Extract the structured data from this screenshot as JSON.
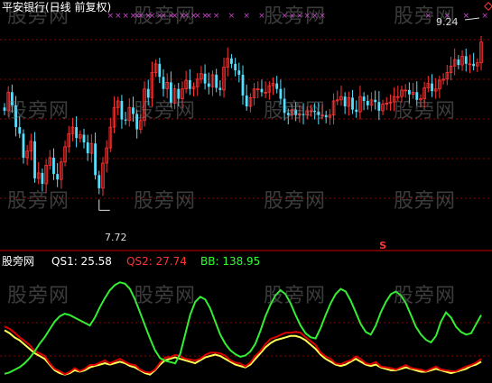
{
  "title": "平安银行(日线 前复权)",
  "watermark": "股旁网",
  "indicator": {
    "name": "股旁网",
    "qs1": "QS1: 25.58",
    "qs2": "QS2: 27.74",
    "bb": "BB: 138.95"
  },
  "colors": {
    "background": "#000000",
    "up_candle": "#ff3333",
    "down_candle": "#55e0ff",
    "grid": "#8b0000",
    "qs1_line": "#ffff55",
    "qs2_line": "#dd0000",
    "bb_line": "#33ee33",
    "marker_x": "#cc44cc",
    "sell_signal": "#ff3333"
  },
  "chart_data": [
    {
      "type": "candlestick",
      "title": "平安银行(日线 前复权)",
      "ylim": [
        7.5,
        9.4
      ],
      "annotations": [
        {
          "text": "9.24",
          "type": "high",
          "index": 126
        },
        {
          "text": "7.72",
          "type": "low",
          "index": 25
        }
      ],
      "sell_signal": {
        "text": "S",
        "index": 100
      },
      "close": [
        8.55,
        8.72,
        8.6,
        8.4,
        8.34,
        8.12,
        8.18,
        8.27,
        7.93,
        7.98,
        7.88,
        8.05,
        8.12,
        7.97,
        7.92,
        8.08,
        8.22,
        8.34,
        8.4,
        8.3,
        8.33,
        8.26,
        8.16,
        8.25,
        7.96,
        7.84,
        8.07,
        8.21,
        8.4,
        8.58,
        8.64,
        8.47,
        8.46,
        8.58,
        8.52,
        8.38,
        8.46,
        8.75,
        8.67,
        8.9,
        8.98,
        8.86,
        8.75,
        8.81,
        8.62,
        8.75,
        8.66,
        8.75,
        8.83,
        8.75,
        8.77,
        8.84,
        8.89,
        8.8,
        8.77,
        8.88,
        8.76,
        8.74,
        8.95,
        9.03,
        8.98,
        8.92,
        8.88,
        8.69,
        8.59,
        8.67,
        8.75,
        8.75,
        8.72,
        8.72,
        8.78,
        8.8,
        8.75,
        8.66,
        8.53,
        8.51,
        8.56,
        8.51,
        8.52,
        8.51,
        8.55,
        8.55,
        8.54,
        8.51,
        8.51,
        8.49,
        8.51,
        8.64,
        8.65,
        8.68,
        8.59,
        8.67,
        8.56,
        8.54,
        8.68,
        8.64,
        8.6,
        8.65,
        8.63,
        8.55,
        8.61,
        8.62,
        8.63,
        8.68,
        8.68,
        8.74,
        8.74,
        8.7,
        8.72,
        8.65,
        8.66,
        8.76,
        8.8,
        8.73,
        8.75,
        8.83,
        8.84,
        8.9,
        8.96,
        9.02,
        8.97,
        9.05,
        8.98,
        8.98,
        8.96,
        8.99,
        9.18
      ],
      "markers_x_count": 34
    },
    {
      "type": "line",
      "series": [
        {
          "name": "QS1",
          "last": 25.58
        },
        {
          "name": "QS2",
          "last": 27.74
        },
        {
          "name": "BB",
          "last": 138.95
        }
      ]
    }
  ]
}
